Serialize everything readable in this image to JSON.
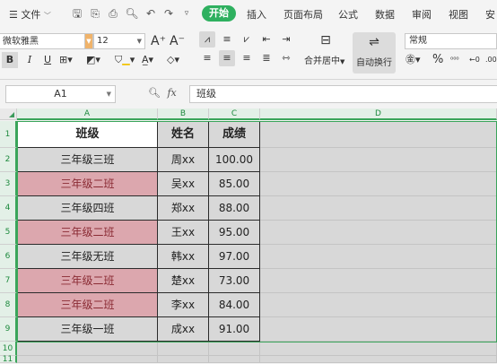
{
  "menu": {
    "file": "文件",
    "tabs": [
      "开始",
      "插入",
      "页面布局",
      "公式",
      "数据",
      "审阅",
      "视图",
      "安"
    ]
  },
  "ribbon": {
    "font_name": "微软雅黑",
    "font_size": "12",
    "bold": "B",
    "italic": "I",
    "underline": "U",
    "merge_center": "合并居中",
    "auto_wrap": "自动换行",
    "number_format": "常规",
    "percent": "%"
  },
  "formula_bar": {
    "cell_ref": "A1",
    "fx": "fx",
    "content": "班级"
  },
  "sheet": {
    "columns": [
      "A",
      "B",
      "C",
      "D"
    ],
    "rows": [
      "1",
      "2",
      "3",
      "4",
      "5",
      "6",
      "7",
      "8",
      "9",
      "10",
      "11"
    ],
    "headers": [
      "班级",
      "姓名",
      "成绩"
    ],
    "data": [
      {
        "class": "三年级三班",
        "name": "周xx",
        "score": "100.00",
        "highlight": false
      },
      {
        "class": "三年级二班",
        "name": "吴xx",
        "score": "85.00",
        "highlight": true
      },
      {
        "class": "三年级四班",
        "name": "郑xx",
        "score": "88.00",
        "highlight": false
      },
      {
        "class": "三年级二班",
        "name": "王xx",
        "score": "95.00",
        "highlight": true
      },
      {
        "class": "三年级无班",
        "name": "韩xx",
        "score": "97.00",
        "highlight": false
      },
      {
        "class": "三年级二班",
        "name": "楚xx",
        "score": "73.00",
        "highlight": true
      },
      {
        "class": "三年级二班",
        "name": "李xx",
        "score": "84.00",
        "highlight": true
      },
      {
        "class": "三年级一班",
        "name": "成xx",
        "score": "91.00",
        "highlight": false
      }
    ]
  },
  "colors": {
    "accent_green": "#2eb05f",
    "highlight_fill": "#dca7ae",
    "highlight_text": "#8a2b34",
    "cell_fill": "#d8d8d8"
  }
}
